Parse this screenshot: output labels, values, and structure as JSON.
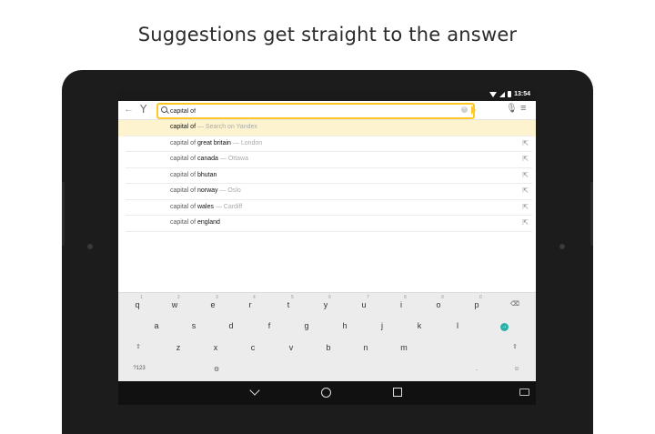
{
  "headline": "Suggestions get straight to the answer",
  "status_bar": {
    "time": "13:54"
  },
  "toolbar": {
    "logo": "Y",
    "search_value": "capital of",
    "back_icon": "arrow-left-icon",
    "mic_icon": "microphone-icon",
    "menu_icon": "hamburger-icon"
  },
  "suggestions": [
    {
      "prefix": "capital of",
      "term": "",
      "extra": " — Search on Yandex",
      "highlighted": true
    },
    {
      "prefix": "capital of ",
      "term": "great britain",
      "extra": " — London"
    },
    {
      "prefix": "capital of ",
      "term": "canada",
      "extra": " — Ottawa"
    },
    {
      "prefix": "capital of ",
      "term": "bhutan",
      "extra": ""
    },
    {
      "prefix": "capital of ",
      "term": "norway",
      "extra": " — Oslo"
    },
    {
      "prefix": "capital of ",
      "term": "wales",
      "extra": " — Cardiff"
    },
    {
      "prefix": "capital of ",
      "term": "england",
      "extra": ""
    }
  ],
  "keyboard": {
    "row1": [
      "q",
      "w",
      "e",
      "r",
      "t",
      "y",
      "u",
      "i",
      "o",
      "p"
    ],
    "row1_nums": [
      "1",
      "2",
      "3",
      "4",
      "5",
      "6",
      "7",
      "8",
      "9",
      "0"
    ],
    "row2": [
      "a",
      "s",
      "d",
      "f",
      "g",
      "h",
      "j",
      "k",
      "l"
    ],
    "row3": [
      "z",
      "x",
      "c",
      "v",
      "b",
      "n",
      "m"
    ],
    "symbols_key": "?123",
    "period_key": "."
  },
  "colors": {
    "accent": "#ffc824",
    "go_button": "#2bb3a8",
    "highlight_row": "#fdf3cf"
  }
}
